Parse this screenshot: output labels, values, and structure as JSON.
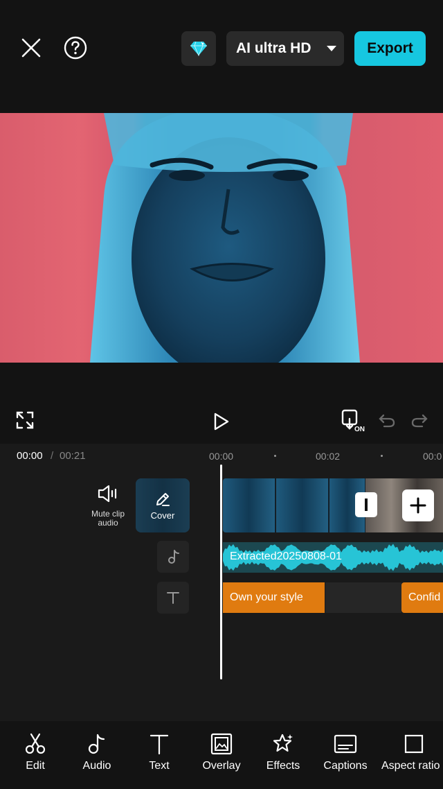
{
  "topbar": {
    "quality_label": "AI ultra HD",
    "export_label": "Export"
  },
  "controls": {
    "snap_badge": "ON"
  },
  "timeline": {
    "current_time": "00:00",
    "separator": "/",
    "total_time": "00:21",
    "ruler": [
      "00:00",
      "00:02",
      "00:0"
    ],
    "mute_label_line1": "Mute clip",
    "mute_label_line2": "audio",
    "cover_label": "Cover",
    "audio_track_label": "Extracted20250808-01",
    "text_clips": [
      "Own your style",
      "Confid"
    ]
  },
  "toolbar": {
    "items": [
      {
        "label": "Edit",
        "icon": "scissors-icon"
      },
      {
        "label": "Audio",
        "icon": "music-note-icon"
      },
      {
        "label": "Text",
        "icon": "text-icon"
      },
      {
        "label": "Overlay",
        "icon": "overlay-icon"
      },
      {
        "label": "Effects",
        "icon": "effects-star-icon"
      },
      {
        "label": "Captions",
        "icon": "captions-icon"
      },
      {
        "label": "Aspect ratio",
        "icon": "aspect-ratio-icon"
      }
    ]
  },
  "colors": {
    "accent": "#16c7e0",
    "text_clip": "#e07b10",
    "audio_wave": "#27c4d6",
    "background": "#131313"
  }
}
